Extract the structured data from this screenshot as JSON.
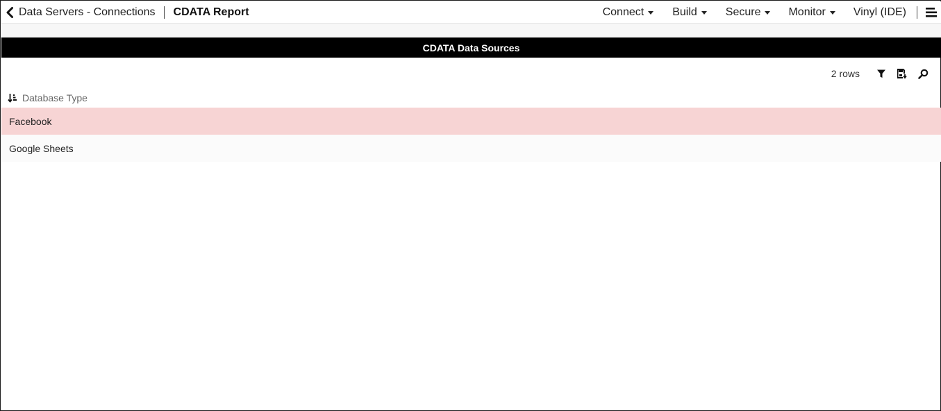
{
  "header": {
    "back_label": "Data Servers - Connections",
    "page_title": "CDATA Report",
    "nav": [
      {
        "label": "Connect"
      },
      {
        "label": "Build"
      },
      {
        "label": "Secure"
      },
      {
        "label": "Monitor"
      },
      {
        "label": "Vinyl (IDE)"
      }
    ],
    "icons": {
      "back": "chevron-left-icon",
      "menu": "hamburger-menu-icon"
    }
  },
  "section": {
    "title": "CDATA Data Sources"
  },
  "toolbar": {
    "row_count": "2 rows",
    "icons": [
      "filter-icon",
      "export-icon",
      "search-icon"
    ]
  },
  "grid": {
    "sort_icon": "sort-ascending-icon",
    "column_header": "Database Type",
    "rows": [
      {
        "database_type": "Facebook",
        "selected": true
      },
      {
        "database_type": "Google Sheets",
        "selected": false
      }
    ]
  },
  "colors": {
    "section_header_bg": "#000000",
    "selected_row_bg": "#f7d4d4",
    "text": "#222222"
  }
}
